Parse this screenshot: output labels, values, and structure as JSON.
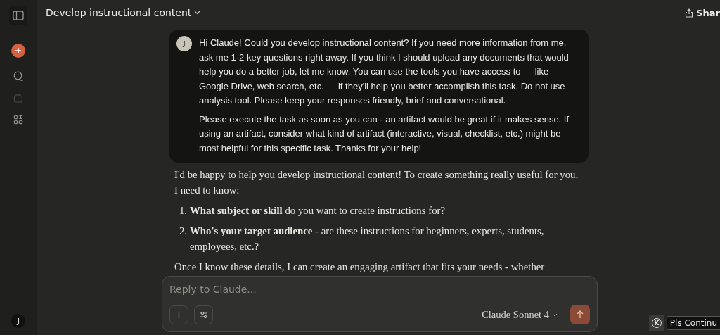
{
  "header": {
    "title": "Develop instructional content",
    "share_label": "Shar"
  },
  "user_message": {
    "avatar": "J",
    "paragraphs": [
      "Hi Claude! Could you develop instructional content? If you need more information from me, ask me 1-2 key questions right away. If you think I should upload any documents that would help you do a better job, let me know. You can use the tools you have access to — like Google Drive, web search, etc. — if they'll help you better accomplish this task. Do not use analysis tool. Please keep your responses friendly, brief and conversational.",
      "Please execute the task as soon as you can - an artifact would be great if it makes sense. If using an artifact, consider what kind of artifact (interactive, visual, checklist, etc.) might be most helpful for this specific task. Thanks for your help!"
    ]
  },
  "assistant_message": {
    "intro": "I'd be happy to help you develop instructional content! To create something really useful for you, I need to know:",
    "questions": [
      {
        "number": "1.",
        "text": "**What subject or skill** do you want to create instructions for?"
      },
      {
        "number": "2.",
        "text": "**Who's your target audience** - are these instructions for beginners, experts, students, employees, etc.?"
      }
    ],
    "outro": "Once I know these details, I can create an engaging artifact that fits your needs - whether"
  },
  "composer": {
    "placeholder": "Reply to Claude...",
    "model": "Claude Sonnet 4"
  },
  "sidebar": {
    "user_avatar": "J"
  },
  "extension": {
    "badge": "K",
    "label": "Pls Continu"
  }
}
